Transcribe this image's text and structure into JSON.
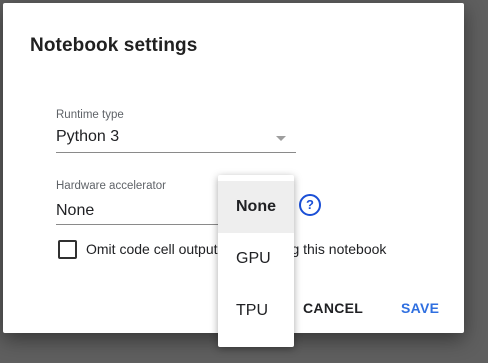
{
  "dialog": {
    "title": "Notebook settings",
    "runtime": {
      "label": "Runtime type",
      "value": "Python 3"
    },
    "accelerator": {
      "label": "Hardware accelerator",
      "value": "None",
      "help_icon": "help-circle-icon",
      "help_glyph": "?",
      "options": [
        "None",
        "GPU",
        "TPU"
      ],
      "selected": "None"
    },
    "omit_output": {
      "label": "Omit code cell output when saving this notebook",
      "checked": false
    },
    "buttons": {
      "cancel": "CANCEL",
      "save": "SAVE"
    }
  },
  "colors": {
    "accent": "#1a4fd6",
    "save": "#2f6fe0",
    "backdrop": "#5f5f5f"
  }
}
